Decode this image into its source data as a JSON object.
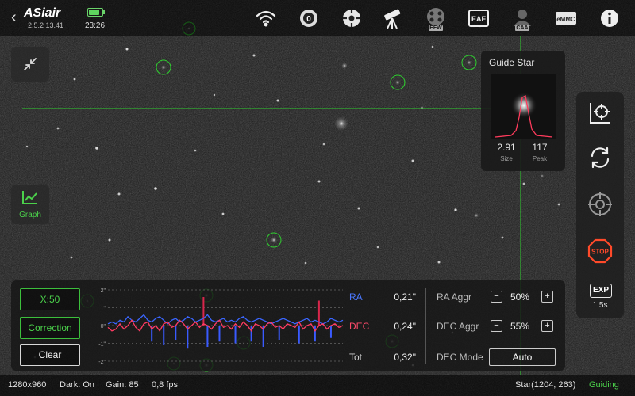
{
  "header": {
    "logo": "ASiair",
    "version": "2.5.2 13.41",
    "time": "23:26",
    "battery_level": 0.85,
    "status_icons": [
      {
        "name": "wifi-icon"
      },
      {
        "name": "camera-icon",
        "badge": "0"
      },
      {
        "name": "guide-scope-icon"
      },
      {
        "name": "telescope-icon"
      },
      {
        "name": "filter-wheel-icon",
        "label": "EFW"
      },
      {
        "name": "focuser-icon",
        "label": "EAF"
      },
      {
        "name": "caa-icon",
        "label": "CAA"
      },
      {
        "name": "storage-icon",
        "label": "eMMC"
      },
      {
        "name": "info-icon"
      }
    ]
  },
  "left": {
    "graph_label": "Graph"
  },
  "guide_star": {
    "title": "Guide Star",
    "size_value": "2.91",
    "size_label": "Size",
    "peak_value": "117",
    "peak_label": "Peak"
  },
  "right_toolbar": {
    "exposure_label": "EXP",
    "exposure_value": "1,5s",
    "stop_label": "STOP"
  },
  "graph_panel": {
    "zoom_button": "X:50",
    "correction_button": "Correction",
    "clear_button": "Clear",
    "ra_label": "RA",
    "ra_value": "0,21\"",
    "dec_label": "DEC",
    "dec_value": "0,24\"",
    "tot_label": "Tot",
    "tot_value": "0,32\"",
    "ra_aggr_label": "RA Aggr",
    "ra_aggr_value": "50%",
    "dec_aggr_label": "DEC Aggr",
    "dec_aggr_value": "55%",
    "dec_mode_label": "DEC Mode",
    "dec_mode_value": "Auto",
    "minus": "−",
    "plus": "+"
  },
  "chart_data": {
    "type": "line",
    "yticks": [
      "2\"",
      "1\"",
      "0\"",
      "-1\"",
      "-2\""
    ],
    "ylim": [
      -2,
      2
    ],
    "series": [
      {
        "color": "#3a66ff",
        "values": [
          0.1,
          0.2,
          0.1,
          0.3,
          0.2,
          0.5,
          0.3,
          0.2,
          0.4,
          0.6,
          0.3,
          0.2,
          0.4,
          0.5,
          0.3,
          0.1,
          0.3,
          0.4,
          0.2,
          0.3,
          0.5,
          0.4,
          0.2,
          0.3,
          0.4,
          0.6,
          0.3,
          0.2,
          0.3,
          0.4,
          0.2,
          0.3,
          0.2,
          0.4,
          0.5,
          0.3,
          0.2,
          0.3,
          0.4,
          0.3,
          0.2,
          0.1,
          0.2,
          0.3,
          0.4,
          0.3,
          0.2,
          0.1,
          0.2,
          0.3,
          0.4,
          0.2,
          0.3,
          0.2,
          0.1,
          0.2,
          0.4,
          0.3,
          0.2,
          0.3
        ]
      },
      {
        "color": "#ff3b62",
        "values": [
          -0.1,
          -0.3,
          -0.2,
          0.1,
          -0.2,
          0.0,
          0.3,
          -0.1,
          -0.3,
          0.1,
          0.2,
          -0.2,
          0.0,
          -0.3,
          0.1,
          0.2,
          -0.1,
          0.0,
          0.3,
          0.1,
          -0.2,
          0.0,
          0.2,
          -0.1,
          0.1,
          0.0,
          -0.2,
          0.1,
          0.3,
          -0.1,
          0.0,
          -0.2,
          0.1,
          -0.1,
          0.2,
          0.0,
          -0.3,
          0.1,
          0.0,
          -0.2,
          0.1,
          0.2,
          -0.1,
          0.0,
          -0.2,
          0.1,
          0.0,
          -0.1,
          0.2,
          -0.2,
          0.0,
          0.1,
          -0.3,
          0.0,
          0.1,
          -0.2,
          0.0,
          0.1,
          -0.1,
          0.0
        ]
      }
    ],
    "corrections_ra": [
      0,
      0,
      0,
      0,
      0,
      0,
      0,
      0,
      0,
      0,
      0,
      -0.9,
      0,
      0,
      -1.1,
      0,
      0,
      -0.8,
      0,
      0,
      -1.3,
      0,
      0,
      0,
      0,
      -1.2,
      0,
      0,
      -0.9,
      0,
      0,
      0,
      -1.0,
      0,
      0,
      0,
      -0.9,
      0,
      0,
      -1.2,
      0,
      0,
      0,
      -0.8,
      0,
      0,
      0,
      0,
      -1.0,
      0,
      0,
      0,
      -0.9,
      0,
      0,
      0,
      -0.7,
      0,
      0,
      0
    ],
    "corrections_dec": [
      0,
      0,
      0,
      0,
      0,
      0,
      0,
      0,
      0,
      0,
      0,
      0,
      0,
      0,
      0,
      0,
      0,
      0,
      0,
      0,
      0,
      0,
      0,
      0,
      1.6,
      0,
      0,
      0,
      0,
      0,
      0,
      0,
      0,
      0,
      0,
      0,
      0,
      0,
      0,
      0,
      0,
      0,
      0,
      0,
      0,
      0,
      0,
      0,
      0,
      0,
      0,
      0,
      0,
      1.4,
      0,
      0,
      0,
      0,
      0,
      0
    ]
  },
  "status": {
    "resolution": "1280x960",
    "dark": "Dark: On",
    "gain": "Gain: 85",
    "fps": "0,8 fps",
    "star": "Star(1204, 263)",
    "state": "Guiding"
  }
}
